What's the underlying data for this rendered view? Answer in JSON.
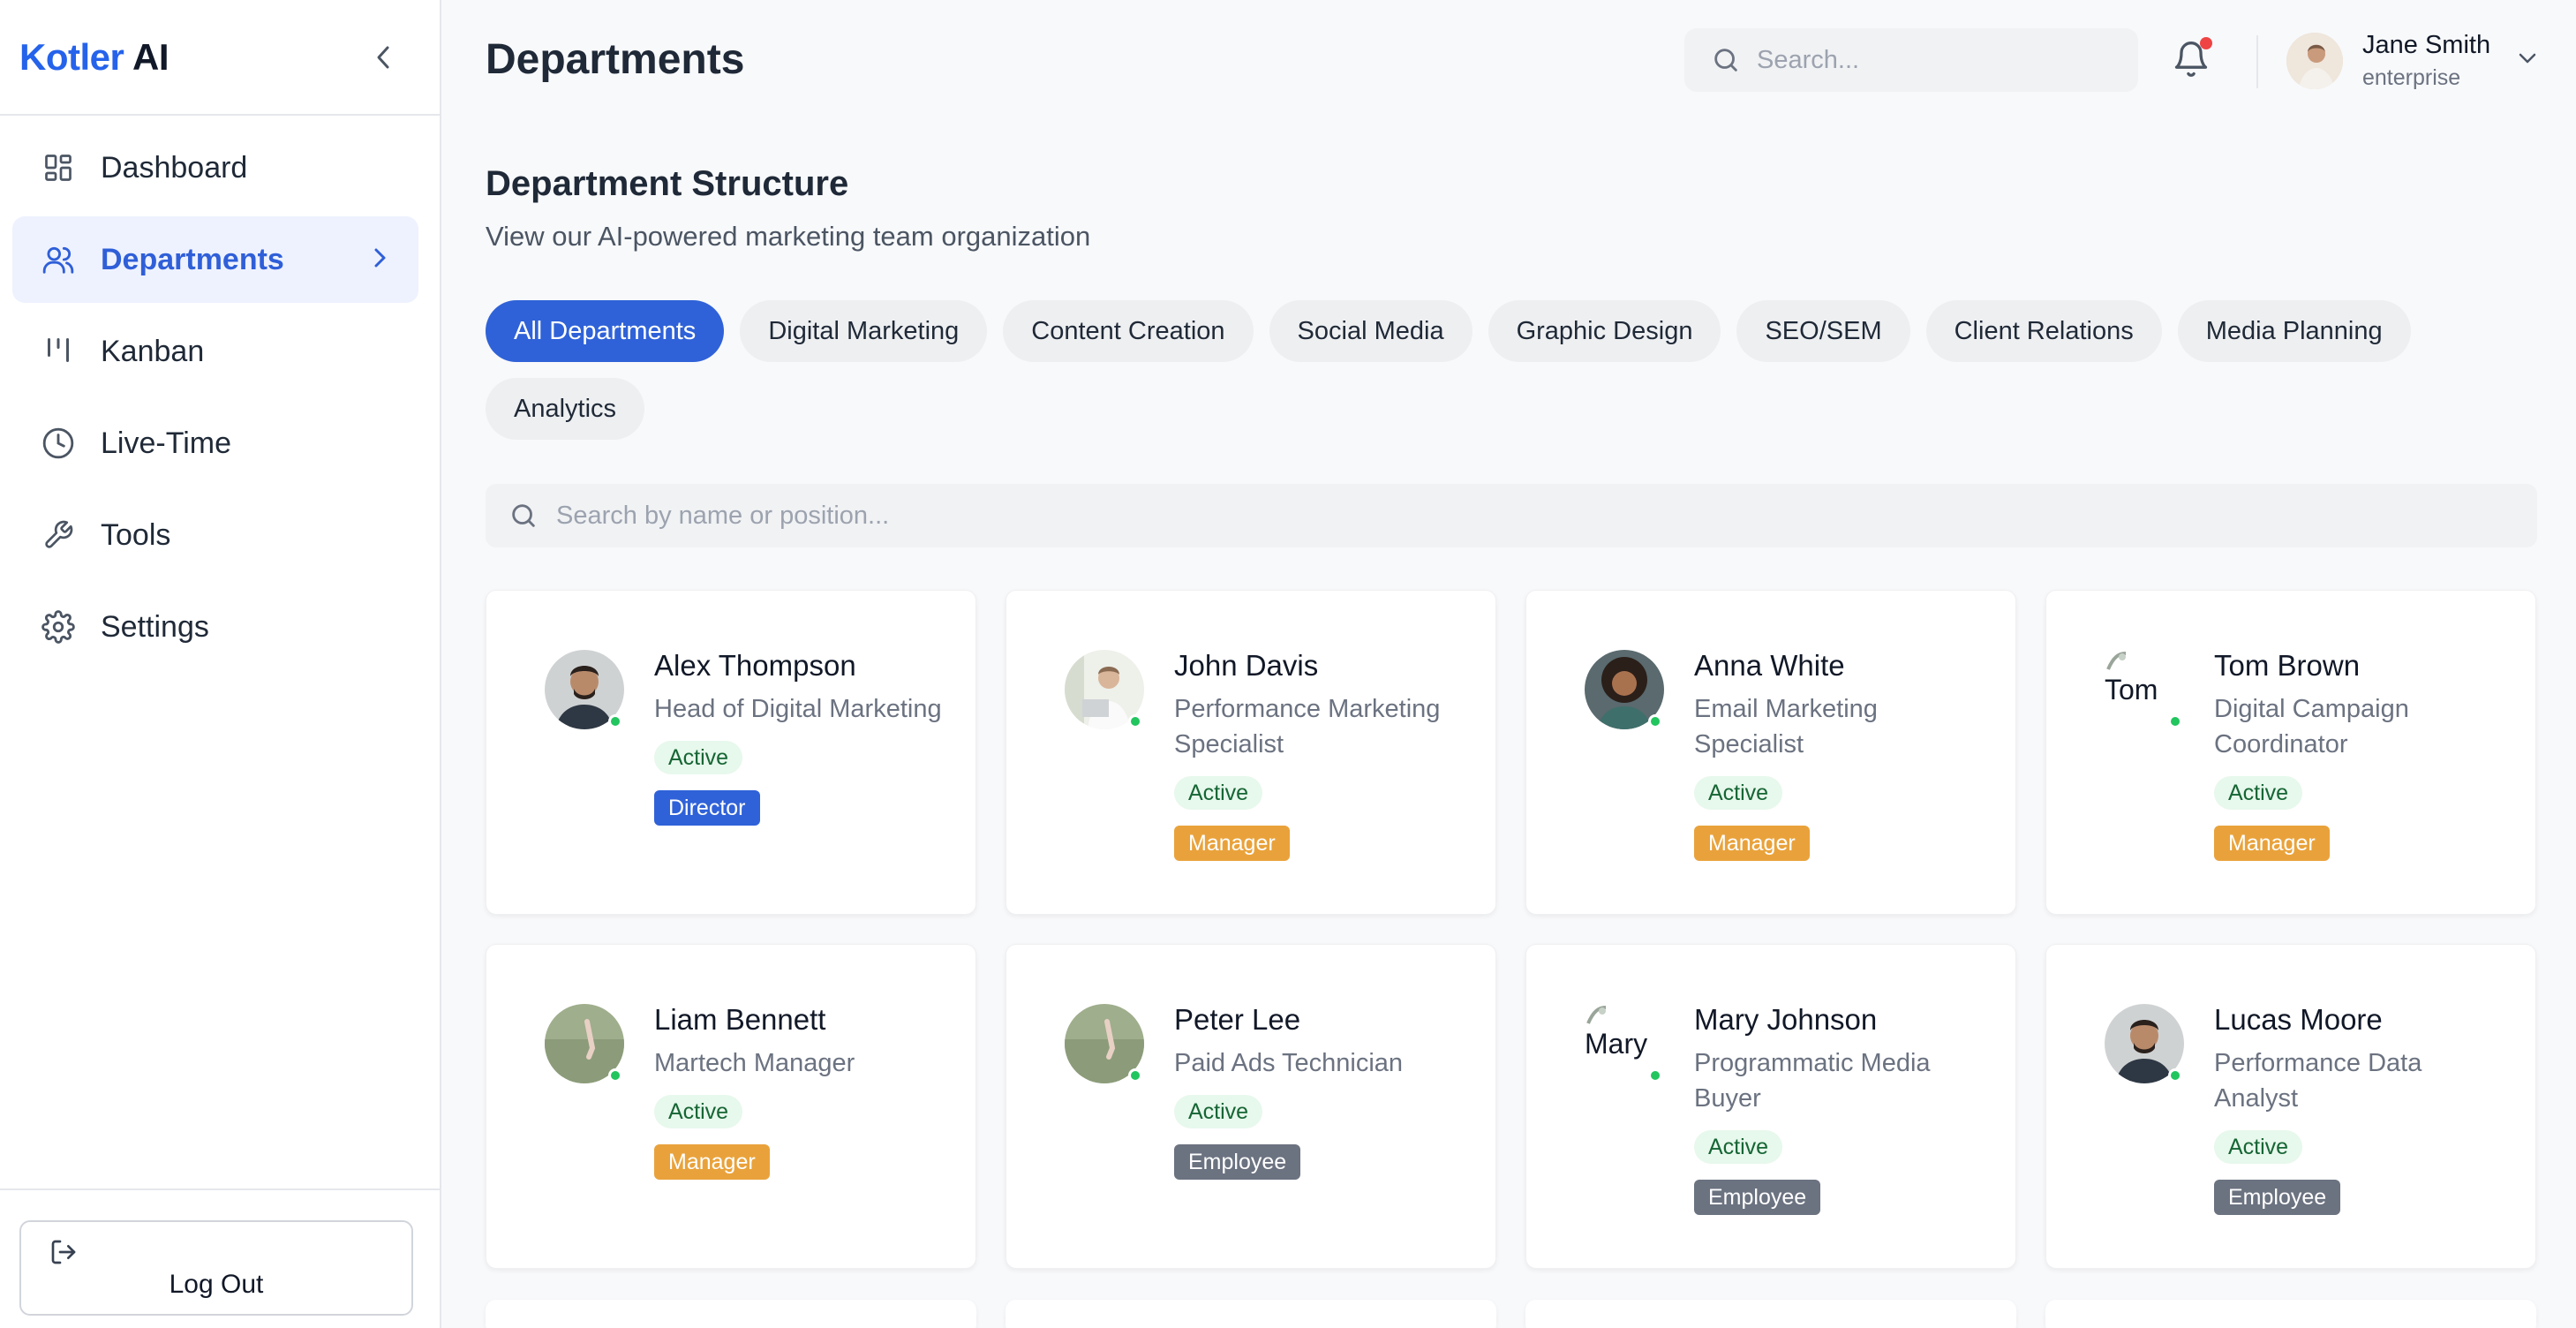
{
  "brand": {
    "part1": "Kotler",
    "part2": "AI"
  },
  "sidebar": {
    "items": [
      {
        "label": "Dashboard",
        "icon": "dashboard-icon"
      },
      {
        "label": "Departments",
        "icon": "users-icon"
      },
      {
        "label": "Kanban",
        "icon": "kanban-icon"
      },
      {
        "label": "Live-Time",
        "icon": "clock-icon"
      },
      {
        "label": "Tools",
        "icon": "wrench-icon"
      },
      {
        "label": "Settings",
        "icon": "gear-icon"
      }
    ],
    "logout_label": "Log Out"
  },
  "header": {
    "title": "Departments",
    "search_placeholder": "Search...",
    "user_name": "Jane Smith",
    "user_plan": "enterprise"
  },
  "section": {
    "title": "Department Structure",
    "subtitle": "View our AI-powered marketing team organization"
  },
  "filters": [
    "All Departments",
    "Digital Marketing",
    "Content Creation",
    "Social Media",
    "Graphic Design",
    "SEO/SEM",
    "Client Relations",
    "Media Planning",
    "Analytics"
  ],
  "people_search_placeholder": "Search by name or position...",
  "cards": [
    {
      "name": "Alex Thompson",
      "role": "Head of Digital Marketing",
      "status": "Active",
      "level": "Director",
      "alt": ""
    },
    {
      "name": "John Davis",
      "role": "Performance Marketing Specialist",
      "status": "Active",
      "level": "Manager",
      "alt": ""
    },
    {
      "name": "Anna White",
      "role": "Email Marketing Specialist",
      "status": "Active",
      "level": "Manager",
      "alt": ""
    },
    {
      "name": "Tom Brown",
      "role": "Digital Campaign Coordinator",
      "status": "Active",
      "level": "Manager",
      "alt": "Tom"
    },
    {
      "name": "Liam Bennett",
      "role": "Martech Manager",
      "status": "Active",
      "level": "Manager",
      "alt": ""
    },
    {
      "name": "Peter Lee",
      "role": "Paid Ads Technician",
      "status": "Active",
      "level": "Employee",
      "alt": ""
    },
    {
      "name": "Mary Johnson",
      "role": "Programmatic Media Buyer",
      "status": "Active",
      "level": "Employee",
      "alt": "Mary"
    },
    {
      "name": "Lucas Moore",
      "role": "Performance Data Analyst",
      "status": "Active",
      "level": "Employee",
      "alt": ""
    }
  ],
  "colors": {
    "accent": "#2f62d8",
    "manager": "#e9a23b",
    "employee": "#6b7280",
    "active_bg": "#e7f8ec",
    "notification": "#ef4444"
  }
}
